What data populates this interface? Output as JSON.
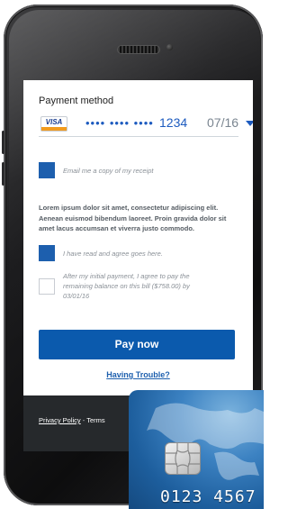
{
  "payment": {
    "section_label": "Payment method",
    "card_brand": "VISA",
    "card_masked": "•••• •••• ••••",
    "card_last4": "1234",
    "card_expiry": "07/16"
  },
  "options": {
    "email_receipt_label": "Email me a copy of my receipt",
    "email_receipt_checked": true,
    "terms_text": "Lorem ipsum dolor sit amet, consectetur adipiscing elit. Aenean euismod bibendum laoreet.  Proin gravida dolor sit amet lacus accumsan et viverra justo commodo.",
    "agree_label": "I have read and agree goes here.",
    "agree_checked": true,
    "remaining_label": "After my initial payment, I agree to pay the remaining balance on this bill ($758.00) by 03/01/16",
    "remaining_checked": false
  },
  "actions": {
    "pay_now": "Pay now",
    "having_trouble": "Having Trouble?"
  },
  "footer": {
    "privacy_policy": "Privacy Policy",
    "separator": "-",
    "terms": "Terms"
  },
  "credit_card": {
    "number_partial": "0123 4567"
  },
  "colors": {
    "accent": "#0b5aad",
    "link": "#1d5fae",
    "footer_bg": "#26292c"
  }
}
